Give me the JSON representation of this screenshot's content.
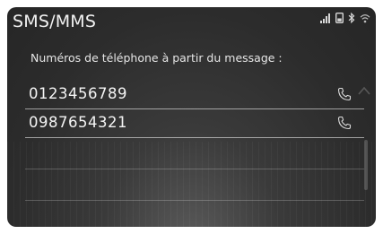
{
  "header": {
    "title": "SMS/MMS"
  },
  "status_bar": {
    "icons": [
      "signal-bars-icon",
      "phone-battery-icon",
      "bluetooth-icon",
      "wifi-icon"
    ]
  },
  "subtitle": "Numéros de téléphone à partir du message :",
  "phone_numbers": [
    {
      "number": "0123456789",
      "action_icon": "phone-handset-icon"
    },
    {
      "number": "0987654321",
      "action_icon": "phone-handset-icon"
    }
  ],
  "colors": {
    "background": "#2c2c2c",
    "text": "#f4f4f4",
    "divider": "#8c8c8c"
  }
}
